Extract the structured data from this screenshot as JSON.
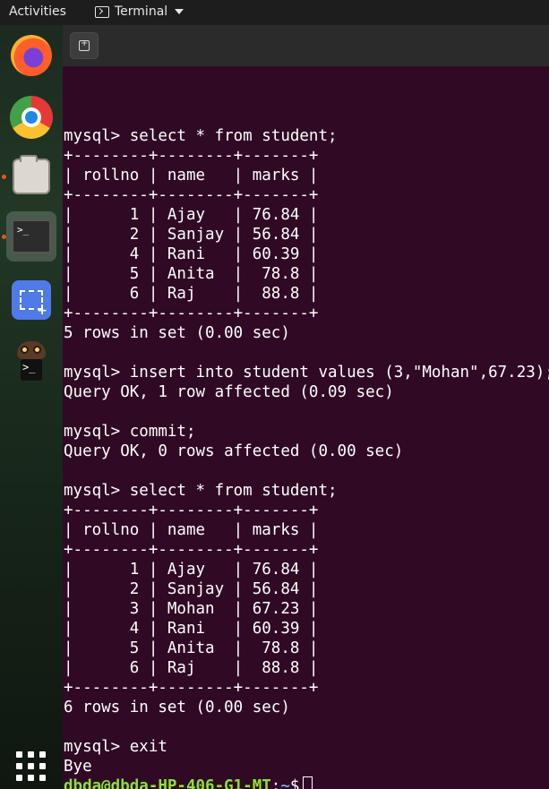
{
  "topbar": {
    "activities": "Activities",
    "app_name": "Terminal"
  },
  "dock": {
    "items": [
      "firefox-icon",
      "chrome-icon",
      "files-icon",
      "terminal-icon",
      "screenshot-icon",
      "mysql-workbench-icon",
      "show-apps-icon"
    ]
  },
  "terminal": {
    "lines": [
      "mysql> select * from student;",
      "+--------+--------+-------+",
      "| rollno | name   | marks |",
      "+--------+--------+-------+",
      "|      1 | Ajay   | 76.84 |",
      "|      2 | Sanjay | 56.84 |",
      "|      4 | Rani   | 60.39 |",
      "|      5 | Anita  |  78.8 |",
      "|      6 | Raj    |  88.8 |",
      "+--------+--------+-------+",
      "5 rows in set (0.00 sec)",
      "",
      "mysql> insert into student values (3,\"Mohan\",67.23);",
      "Query OK, 1 row affected (0.09 sec)",
      "",
      "mysql> commit;",
      "Query OK, 0 rows affected (0.00 sec)",
      "",
      "mysql> select * from student;",
      "+--------+--------+-------+",
      "| rollno | name   | marks |",
      "+--------+--------+-------+",
      "|      1 | Ajay   | 76.84 |",
      "|      2 | Sanjay | 56.84 |",
      "|      3 | Mohan  | 67.23 |",
      "|      4 | Rani   | 60.39 |",
      "|      5 | Anita  |  78.8 |",
      "|      6 | Raj    |  88.8 |",
      "+--------+--------+-------+",
      "6 rows in set (0.00 sec)",
      "",
      "mysql> exit",
      "Bye"
    ],
    "prompt": {
      "user_host": "dbda@dbda-HP-406-G1-MT",
      "separator": ":",
      "path": "~",
      "symbol": "$"
    }
  }
}
